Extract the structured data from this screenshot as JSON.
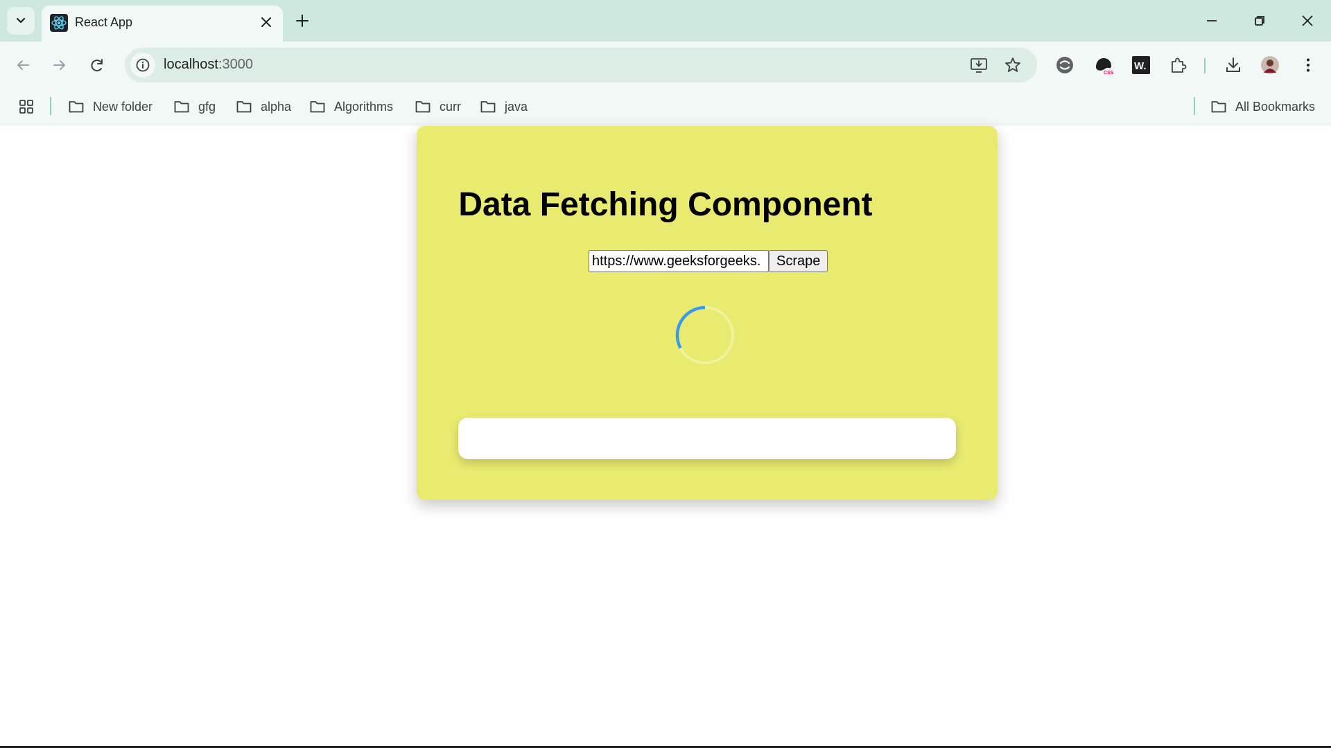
{
  "browser": {
    "tab": {
      "title": "React App",
      "favicon": "react-logo-icon"
    },
    "address": {
      "host": "localhost",
      "port": ":3000"
    },
    "bookmarks": {
      "items": [
        {
          "label": "New folder"
        },
        {
          "label": "gfg"
        },
        {
          "label": "alpha"
        },
        {
          "label": "Algorithms"
        },
        {
          "label": "curr"
        },
        {
          "label": "java"
        }
      ],
      "all_bookmarks": "All Bookmarks"
    },
    "colors": {
      "tab_strip": "#cde8df",
      "toolbar": "#f2f8f5",
      "omnibox": "#dcede6"
    }
  },
  "page": {
    "title": "Data Fetching Component",
    "url_input_value": "https://www.geeksforgeeks.",
    "scrape_label": "Scrape",
    "loading": true,
    "colors": {
      "card": "#e9eb70",
      "spinner": "#3b9ae8"
    }
  }
}
